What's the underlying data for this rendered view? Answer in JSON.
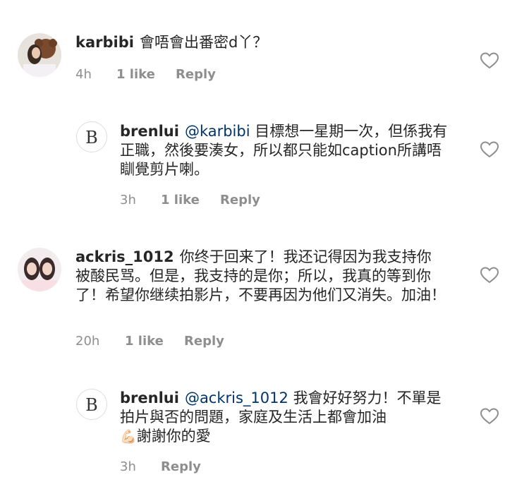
{
  "comments": [
    {
      "username": "karbibi",
      "text": "會唔會出番密d丫？",
      "time": "4h",
      "likes": "1 like",
      "reply": "Reply"
    },
    {
      "username": "brenlui",
      "mention": "@karbibi",
      "text": "目標想一星期一次，但係我有正職，然後要湊女，所以都只能如caption所講唔瞓覺剪片喇。",
      "time": "3h",
      "likes": "1 like",
      "reply": "Reply"
    },
    {
      "username": "ackris_1012",
      "text": "你终于回来了！我还记得因为我支持你被酸民骂。但是，我支持的是你；所以，我真的等到你了！希望你继续拍影片，不要再因为他们又消失。加油！",
      "time": "20h",
      "likes": "1 like",
      "reply": "Reply"
    },
    {
      "username": "brenlui",
      "mention": "@ackris_1012",
      "text": "我會好好努力！不單是拍片與否的問題，家庭及生活上都會加油",
      "emoji": "💪🏻",
      "text2": "謝謝你的愛",
      "time": "3h",
      "reply": "Reply"
    }
  ],
  "colors": {
    "text": "#262626",
    "meta": "#8e8e8e",
    "mention": "#003569",
    "heart": "#8e8e8e"
  }
}
